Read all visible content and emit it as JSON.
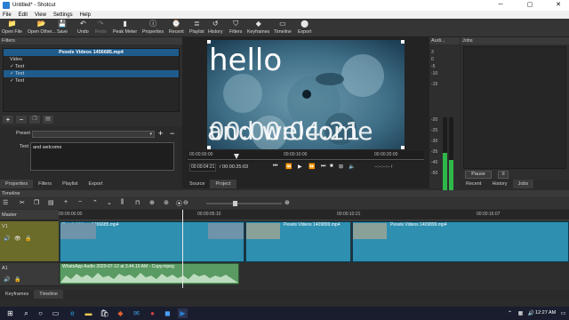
{
  "window": {
    "title": "Untitled* - Shotcut"
  },
  "menu": [
    "File",
    "Edit",
    "View",
    "Settings",
    "Help"
  ],
  "toolbar": [
    {
      "label": "Open File",
      "icon": "open-file-icon",
      "glyph": "📁",
      "enabled": true
    },
    {
      "label": "Open Other...",
      "icon": "open-other-icon",
      "glyph": "📂",
      "enabled": true
    },
    {
      "label": "Save",
      "icon": "save-icon",
      "glyph": "💾",
      "enabled": true
    },
    {
      "label": "Undo",
      "icon": "undo-icon",
      "glyph": "↶",
      "enabled": true
    },
    {
      "label": "Redo",
      "icon": "redo-icon",
      "glyph": "↷",
      "enabled": false
    },
    {
      "label": "Peak Meter",
      "icon": "peak-meter-icon",
      "glyph": "▮",
      "enabled": true
    },
    {
      "label": "Properties",
      "icon": "properties-icon",
      "glyph": "ⓘ",
      "enabled": true
    },
    {
      "label": "Recent",
      "icon": "recent-icon",
      "glyph": "⌚",
      "enabled": true
    },
    {
      "label": "Playlist",
      "icon": "playlist-icon",
      "glyph": "≣",
      "enabled": true
    },
    {
      "label": "History",
      "icon": "history-icon",
      "glyph": "↺",
      "enabled": true
    },
    {
      "label": "Filters",
      "icon": "filters-icon",
      "glyph": "⛉",
      "enabled": true
    },
    {
      "label": "Keyframes",
      "icon": "keyframes-icon",
      "glyph": "◆",
      "enabled": true
    },
    {
      "label": "Timeline",
      "icon": "timeline-icon",
      "glyph": "▭",
      "enabled": true
    },
    {
      "label": "Export",
      "icon": "export-icon",
      "glyph": "⬤",
      "enabled": true
    }
  ],
  "filters": {
    "title": "Filters",
    "clip_name": "Pexels Videos 1456685.mp4",
    "category": "Video",
    "items": [
      "Text",
      "Text",
      "Text"
    ],
    "preset_label": "Preset",
    "text_label": "Text",
    "text_value": "and welcome",
    "tabs": [
      "Properties",
      "Filters",
      "Playlist",
      "Export"
    ]
  },
  "preview": {
    "overlay_top": "hello",
    "overlay_bottom": "and welcome",
    "overlay_timecode": "00:00:04:21",
    "timecode_current": "00:00:04:21",
    "timecode_total": "/ 00:00:25:03",
    "ruler_labels": [
      "00:00:00:00",
      "00:00:10:00",
      "00:00:20:00"
    ],
    "inout": "--:--:--:-- /",
    "tabs": [
      "Source",
      "Project"
    ]
  },
  "audio": {
    "title": "Audi...",
    "scale": [
      "3",
      "0",
      "-5",
      "-10",
      "-15",
      "-20",
      "-25",
      "-30",
      "-35",
      "-40",
      "-50"
    ],
    "channels": [
      "L",
      "R"
    ]
  },
  "jobs": {
    "title": "Jobs",
    "pause_label": "Pause",
    "tabs": [
      "Recent",
      "History",
      "Jobs"
    ]
  },
  "timeline": {
    "title": "Timeline",
    "ruler": [
      "00:00:00:00",
      "00:00:05:10",
      "00:00:10:21",
      "00:00:16:07"
    ],
    "tracks": [
      {
        "name": "Master"
      },
      {
        "name": "V1"
      },
      {
        "name": "A1"
      }
    ],
    "clips_v": [
      "Pexels Videos 1456685.mp4",
      "Pexels Videos 1409899.mp4",
      "Pexels Videos 1409899.mp4"
    ],
    "clip_a": "WhatsApp Audio 2020-07-12 at 3.44.10 AM - Copy.mpeg",
    "bottom_tabs": [
      "Keyframes",
      "Timeline"
    ]
  },
  "taskbar": {
    "time": "12:27 AM",
    "lang": "ENG"
  }
}
